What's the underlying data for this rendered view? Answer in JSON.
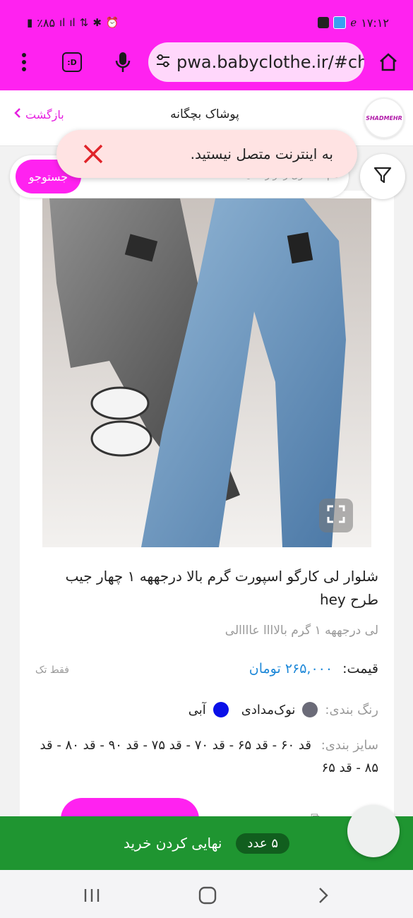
{
  "status_bar": {
    "time": "۱۷:۱۲",
    "battery": "٪۸۵"
  },
  "browser": {
    "url": "pwa.babyclothe.ir/#cha",
    "tab_count": ":D",
    "icons": [
      "home-icon",
      "tune-icon",
      "mic-icon",
      "more-vert-icon"
    ]
  },
  "site": {
    "logo_text": "SHADMEHR",
    "title": "پوشاک بچگانه",
    "back_label": "بازگشت"
  },
  "search": {
    "button_label": "جستوجو",
    "placeholder": "نام محصول را وارد کنید"
  },
  "toast": {
    "message": "به اینترنت متصل نیستید."
  },
  "product": {
    "title": "شلوار لی کارگو اسپورت گرم بالا درجههه ۱ چهار جیب طرح hey",
    "subtitle": "لی درجههه ۱ گرم بالاااا عاااالی",
    "price_label": "قیمت:",
    "price_value": "۲۶۵,۰۰۰ تومان",
    "only_single": "فقط تک",
    "colors_label": "رنگ بندی:",
    "colors": [
      {
        "name": "نوک‌مدادی",
        "hex": "#6b6b78"
      },
      {
        "name": "آبی",
        "hex": "#0a10e8"
      }
    ],
    "sizes_label": "سایز بندی:",
    "sizes_text": "قد ۶۰ - قد ۶۵ - قد ۷۰ - قد ۷۵ - قد ۹۰ - قد ۸۰ - قد ۸۵ - قد ۶۵"
  },
  "checkout": {
    "count": "۵ عدد",
    "label": "نهایی کردن خرید"
  },
  "colors": {
    "accent": "#ff22f0",
    "checkout_green": "#1f9531",
    "price_blue": "#1e88d8"
  }
}
